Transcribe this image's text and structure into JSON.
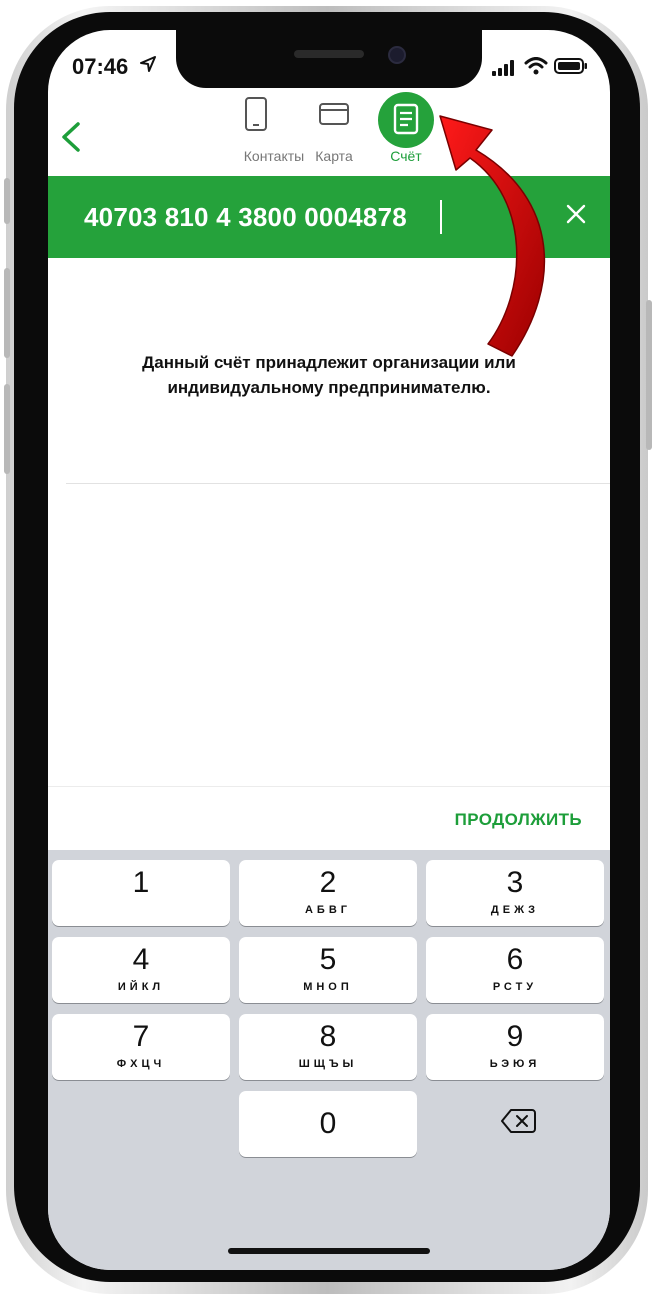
{
  "status_bar": {
    "time": "07:46"
  },
  "tabs": [
    {
      "label": "Контакты",
      "icon": "phone-icon",
      "active": false
    },
    {
      "label": "Карта",
      "icon": "card-icon",
      "active": false
    },
    {
      "label": "Счёт",
      "icon": "document-icon",
      "active": true
    }
  ],
  "account_input": {
    "value": "40703 810 4 3800 0004878"
  },
  "message": {
    "line1": "Данный счёт принадлежит организации или",
    "line2": "индивидуальному предпринимателю."
  },
  "continue_label": "ПРОДОЛЖИТЬ",
  "keypad": [
    {
      "digit": "1",
      "letters": ""
    },
    {
      "digit": "2",
      "letters": "АБВГ"
    },
    {
      "digit": "3",
      "letters": "ДЕЖЗ"
    },
    {
      "digit": "4",
      "letters": "ИЙКЛ"
    },
    {
      "digit": "5",
      "letters": "МНОП"
    },
    {
      "digit": "6",
      "letters": "РСТУ"
    },
    {
      "digit": "7",
      "letters": "ФХЦЧ"
    },
    {
      "digit": "8",
      "letters": "ШЩЪЫ"
    },
    {
      "digit": "9",
      "letters": "ЬЭЮЯ"
    },
    {
      "digit": "0",
      "letters": ""
    }
  ],
  "colors": {
    "accent": "#25a23b",
    "accent_text": "#1d9e3a",
    "annotation_arrow": "#d01010"
  }
}
